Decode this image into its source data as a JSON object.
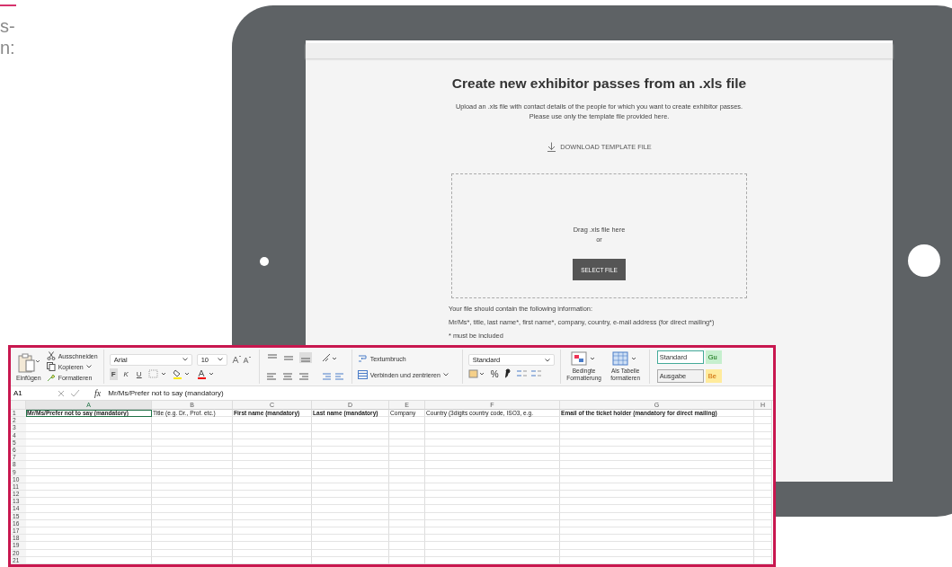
{
  "left_fragment": {
    "lines": [
      "s-",
      "n:"
    ]
  },
  "tablet_page": {
    "title": "Create new exhibitor passes from an .xls file",
    "description_lines": [
      "Upload an .xls file with contact details of the people for which you want to create exhibitor passes.",
      "Please use only the template file provided here."
    ],
    "download_link": "DOWNLOAD TEMPLATE FILE",
    "dropzone": {
      "text": "Drag .xls file here",
      "or": "or",
      "button": "SELECT FILE"
    },
    "info_heading": "Your file should contain the following information:",
    "info_fields": "Mr/Ms*,  title, last name*, first name*, company, country, e-mail address (for direct mailing*)",
    "note": "* must be included"
  },
  "spreadsheet": {
    "ribbon": {
      "paste": "Einfügen",
      "cut": "Ausschneiden",
      "copy": "Kopieren",
      "format_painter": "Formatieren",
      "font": "Arial",
      "font_size": "10",
      "bold": "F",
      "italic": "K",
      "underline": "U",
      "wrap_text": "Textumbruch",
      "merge": "Verbinden und zentrieren",
      "number_format": "Standard",
      "percent": "%",
      "conditional_formatting": "Bedingte Formatierung",
      "format_as_table": "Als Tabelle formatieren",
      "styles": [
        {
          "label": "Standard",
          "color": "#ffffff"
        },
        {
          "label": "Gu",
          "color": "#c6efce"
        },
        {
          "label": "Ausgabe",
          "color": "#f2f2f2"
        },
        {
          "label": "Be",
          "color": "#ffeb9c"
        }
      ]
    },
    "name_box": "A1",
    "function_label": "fx",
    "formula": "Mr/Ms/Prefer not to say (mandatory)",
    "columns": [
      {
        "label": "A",
        "selected": true
      },
      {
        "label": "B",
        "selected": false
      },
      {
        "label": "C",
        "selected": false
      },
      {
        "label": "D",
        "selected": false
      },
      {
        "label": "E",
        "selected": false
      },
      {
        "label": "F",
        "selected": false
      },
      {
        "label": "G",
        "selected": false
      },
      {
        "label": "H",
        "selected": false
      }
    ],
    "row_numbers": [
      "1",
      "2",
      "3",
      "4",
      "5",
      "6",
      "7",
      "8",
      "9",
      "10",
      "11",
      "12",
      "13",
      "14",
      "15",
      "16",
      "17",
      "18",
      "19",
      "20",
      "21"
    ],
    "first_row_cells": [
      {
        "text": "Mr/Ms/Prefer not to say (mandatory)",
        "bold": true,
        "selected": true
      },
      {
        "text": "Title (e.g. Dr., Prof. etc.)",
        "bold": false,
        "selected": false
      },
      {
        "text": "First name (mandatory)",
        "bold": true,
        "selected": false
      },
      {
        "text": "Last name (mandatory)",
        "bold": true,
        "selected": false
      },
      {
        "text": "Company",
        "bold": false,
        "selected": false
      },
      {
        "text": "Country (3digits country code, ISO3, e.g.",
        "bold": false,
        "selected": false
      },
      {
        "text": "Email of the ticket holder (mandatory for direct mailing)",
        "bold": true,
        "selected": false
      }
    ]
  }
}
